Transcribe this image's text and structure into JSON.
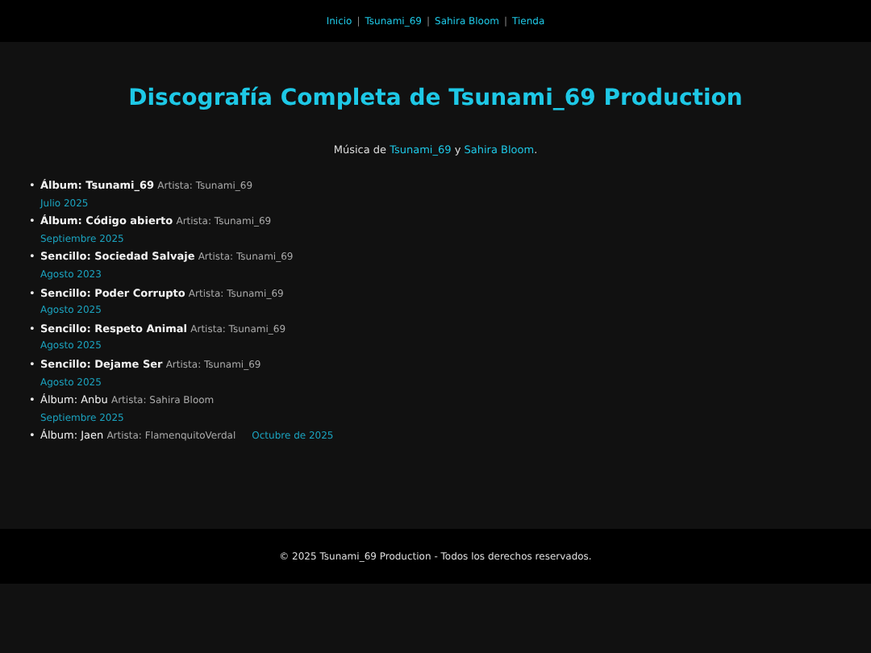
{
  "nav": {
    "links": [
      "Inicio",
      "Tsunami_69",
      "Sahira Bloom",
      "Tienda"
    ],
    "separator": "|"
  },
  "title": "Discografía Completa de Tsunami_69 Production",
  "intro": [
    {
      "kind": "text",
      "text": "Música de "
    },
    {
      "kind": "link",
      "text": "Tsunami_69"
    },
    {
      "kind": "text",
      "text": " y "
    },
    {
      "kind": "link",
      "text": "Sahira Bloom"
    },
    {
      "kind": "text",
      "text": "."
    }
  ],
  "marker": "•",
  "releases": [
    {
      "title": "Álbum: Tsunami_69",
      "artist": "Artista: Tsunami_69",
      "date": "Julio 2025",
      "bold": true,
      "kind": "block"
    },
    {
      "title": "Álbum: Código abierto",
      "artist": "Artista: Tsunami_69",
      "date": "Septiembre 2025",
      "bold": true,
      "kind": "block"
    },
    {
      "title": "Sencillo: Sociedad Salvaje",
      "artist": "Artista: Tsunami_69",
      "date": "Agosto 2023",
      "bold": true,
      "kind": "block"
    },
    {
      "title": "Sencillo: Poder Corrupto",
      "artist": "Artista: Tsunami_69",
      "date": "Agosto 2025",
      "bold": true,
      "kind": "block"
    },
    {
      "title": "Sencillo: Respeto Animal",
      "artist": "Artista: Tsunami_69",
      "date": "Agosto 2025",
      "bold": true,
      "kind": "block"
    },
    {
      "title": "Sencillo: Dejame Ser",
      "artist": "Artista: Tsunami_69",
      "date": "Agosto 2025",
      "bold": true,
      "kind": "block"
    },
    {
      "title": "Álbum: Anbu",
      "artist": "Artista: Sahira Bloom",
      "date": "Septiembre 2025",
      "bold": false,
      "kind": "block"
    },
    {
      "title": "Álbum: Jaen",
      "artist": "Artista: FlamenquitoVerdal",
      "date": "Octubre de 2025",
      "bold": false,
      "kind": "inline"
    }
  ],
  "footer": "© 2025 Tsunami_69 Production - Todos los derechos reservados."
}
